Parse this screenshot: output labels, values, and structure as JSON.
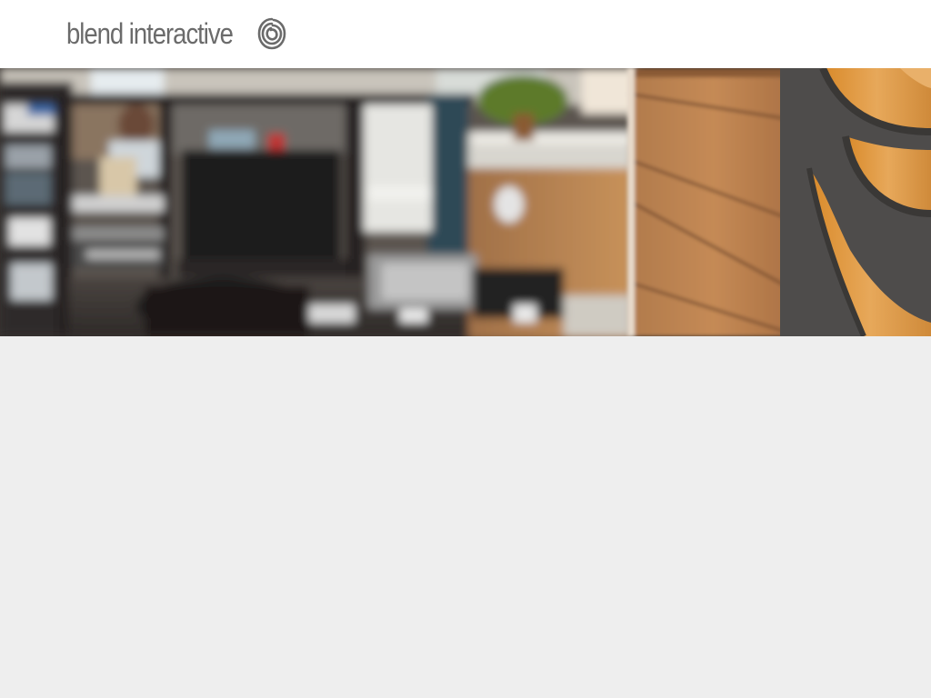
{
  "header": {
    "logo_text": "blend interactive",
    "logo_icon": "swirl-icon"
  },
  "hero": {
    "image_description_icon": "office-photo"
  },
  "colors": {
    "header_bg": "#ffffff",
    "logo_gray": "#6b6b6b",
    "page_bg": "#eeeeee"
  }
}
